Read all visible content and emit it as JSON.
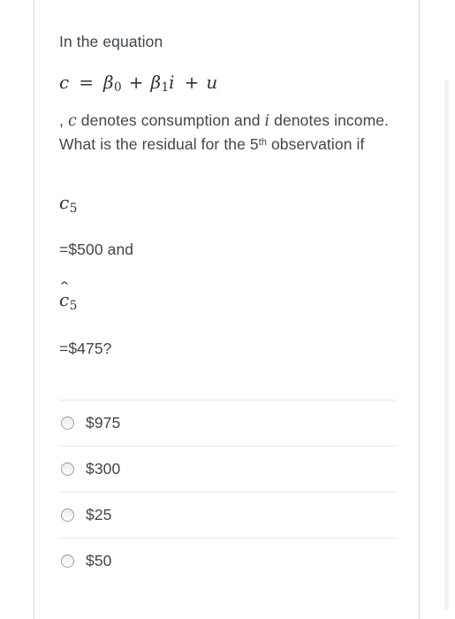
{
  "question": {
    "intro": "In the equation",
    "equation": {
      "lhs": "c",
      "equals": "=",
      "beta0": "β",
      "beta0_sub": "0",
      "plus1": "+",
      "beta1": "β",
      "beta1_sub": "1",
      "i_var": "i",
      "plus2": "+",
      "u_var": "u",
      "plain": "c = β0 + β1 i + u"
    },
    "body_part1": ", ",
    "body_var_c": "c",
    "body_part2": " denotes consumption and ",
    "body_var_i": "i",
    "body_part3": " denotes income. What is the residual for the 5",
    "body_ordinal": "th",
    "body_part4": " observation if",
    "given_c5": {
      "symbol": "c",
      "subscript": "5"
    },
    "given_c5_value": "=$500 and",
    "given_chat5": {
      "hat": "ˆ",
      "symbol": "c",
      "subscript": "5"
    },
    "given_chat5_value": "=$475?"
  },
  "answers": {
    "options": [
      {
        "label": "$975",
        "selected": false
      },
      {
        "label": "$300",
        "selected": false
      },
      {
        "label": "$25",
        "selected": false
      },
      {
        "label": "$50",
        "selected": false
      }
    ]
  },
  "colors": {
    "text": "#3f464d",
    "math_text": "#2f3337",
    "divider": "#e6e8ea",
    "card_border": "#d8dadc",
    "radio_border": "#9aa0a6",
    "scrollbar": "#f2f2f3",
    "background": "#ffffff"
  }
}
